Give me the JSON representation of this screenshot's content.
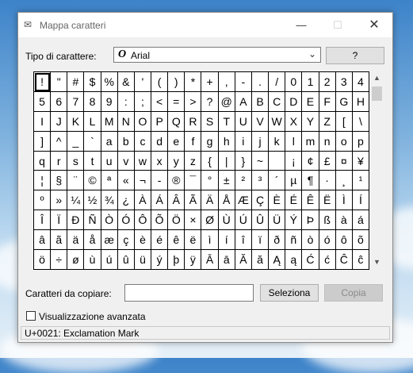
{
  "window": {
    "title": "Mappa caratteri",
    "controls": {
      "minimize": "—",
      "maximize": "☐",
      "close": "✕"
    }
  },
  "font_row": {
    "label": "Tipo di carattere:",
    "selected_font": "Arial",
    "help_label": "?"
  },
  "grid": {
    "selected_index": 0,
    "cells": [
      "!",
      "\"",
      "#",
      "$",
      "%",
      "&",
      "'",
      "(",
      ")",
      "*",
      "+",
      ",",
      "-",
      ".",
      "/",
      "0",
      "1",
      "2",
      "3",
      "4",
      "5",
      "6",
      "7",
      "8",
      "9",
      ":",
      ";",
      "<",
      "=",
      ">",
      "?",
      "@",
      "A",
      "B",
      "C",
      "D",
      "E",
      "F",
      "G",
      "H",
      "I",
      "J",
      "K",
      "L",
      "M",
      "N",
      "O",
      "P",
      "Q",
      "R",
      "S",
      "T",
      "U",
      "V",
      "W",
      "X",
      "Y",
      "Z",
      "[",
      "\\",
      "]",
      "^",
      "_",
      "`",
      "a",
      "b",
      "c",
      "d",
      "e",
      "f",
      "g",
      "h",
      "i",
      "j",
      "k",
      "l",
      "m",
      "n",
      "o",
      "p",
      "q",
      "r",
      "s",
      "t",
      "u",
      "v",
      "w",
      "x",
      "y",
      "z",
      "{",
      "|",
      "}",
      "~",
      " ",
      "¡",
      "¢",
      "£",
      "¤",
      "¥",
      "¦",
      "§",
      "¨",
      "©",
      "ª",
      "«",
      "¬",
      "-",
      "®",
      "¯",
      "°",
      "±",
      "²",
      "³",
      "´",
      "µ",
      "¶",
      "·",
      "¸",
      "¹",
      "º",
      "»",
      "¼",
      "½",
      "¾",
      "¿",
      "À",
      "Á",
      "Â",
      "Ã",
      "Ä",
      "Å",
      "Æ",
      "Ç",
      "È",
      "É",
      "Ê",
      "Ë",
      "Ì",
      "Í",
      "Î",
      "Ï",
      "Ð",
      "Ñ",
      "Ò",
      "Ó",
      "Ô",
      "Õ",
      "Ö",
      "×",
      "Ø",
      "Ù",
      "Ú",
      "Û",
      "Ü",
      "Ý",
      "Þ",
      "ß",
      "à",
      "á",
      "â",
      "ã",
      "ä",
      "å",
      "æ",
      "ç",
      "è",
      "é",
      "ê",
      "ë",
      "ì",
      "í",
      "î",
      "ï",
      "ð",
      "ñ",
      "ò",
      "ó",
      "ô",
      "õ",
      "ö",
      "÷",
      "ø",
      "ù",
      "ú",
      "û",
      "ü",
      "ý",
      "þ",
      "ÿ",
      "Ā",
      "ā",
      "Ă",
      "ă",
      "Ą",
      "ą",
      "Ć",
      "ć",
      "Ĉ",
      "ĉ"
    ]
  },
  "scrollbar": {
    "up_icon": "chevron-up-icon",
    "down_icon": "chevron-down-icon",
    "up_glyph": "▲",
    "down_glyph": "▼"
  },
  "copy_row": {
    "label": "Caratteri da copiare:",
    "value": "",
    "select_label": "Seleziona",
    "copy_label": "Copia"
  },
  "advanced": {
    "label": "Visualizzazione avanzata",
    "checked": false
  },
  "status": {
    "text": "U+0021: Exclamation Mark"
  }
}
